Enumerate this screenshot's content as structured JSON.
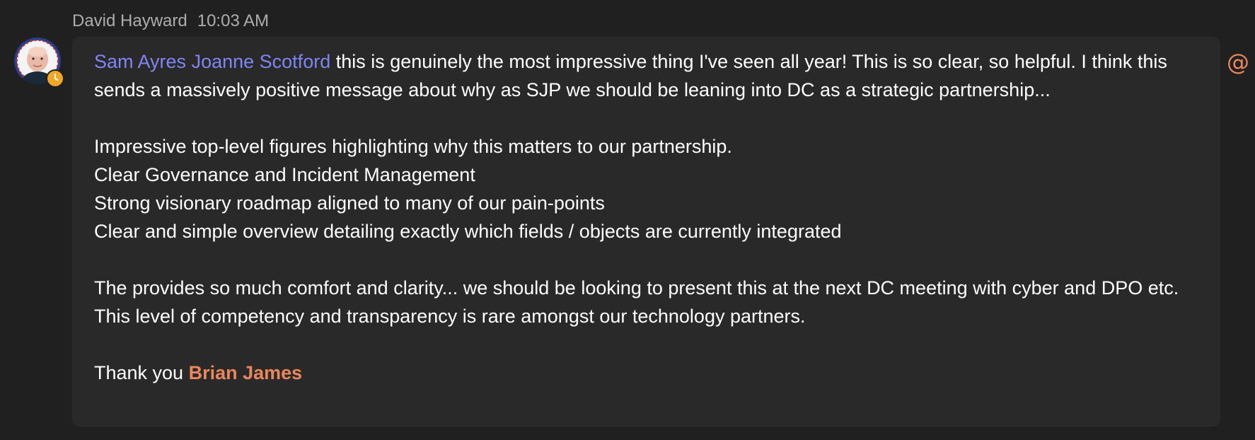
{
  "message": {
    "author": "David Hayward",
    "time": "10:03 AM",
    "mention_1": "Sam Ayres",
    "mention_2": "Joanne Scotford",
    "paragraph_1_rest": " this is genuinely the most impressive thing I've seen all year! This is so clear, so helpful. I think this sends a massively positive message about why as SJP we should be leaning into DC as a strategic partnership...",
    "lines": [
      "Impressive top-level figures highlighting why this matters to our partnership.",
      "Clear Governance and Incident Management",
      "Strong visionary roadmap aligned to many of our pain-points",
      "Clear and simple overview detailing exactly which fields / objects are currently integrated"
    ],
    "paragraph_3": "The provides so much comfort and clarity... we should be looking to present this at the next DC meeting with cyber and DPO etc. This level of competency and transparency is rare amongst our technology partners.",
    "thanks_prefix": "Thank you ",
    "mention_me": "Brian James",
    "at_icon": "@"
  },
  "colors": {
    "background": "#202020",
    "bubble": "#292929",
    "mention": "#7f85f5",
    "self_mention": "#e9875b",
    "status_away": "#f2a626"
  },
  "icons": {
    "avatar": "user-avatar",
    "status": "clock-icon",
    "mention_indicator": "at-mention-icon"
  }
}
